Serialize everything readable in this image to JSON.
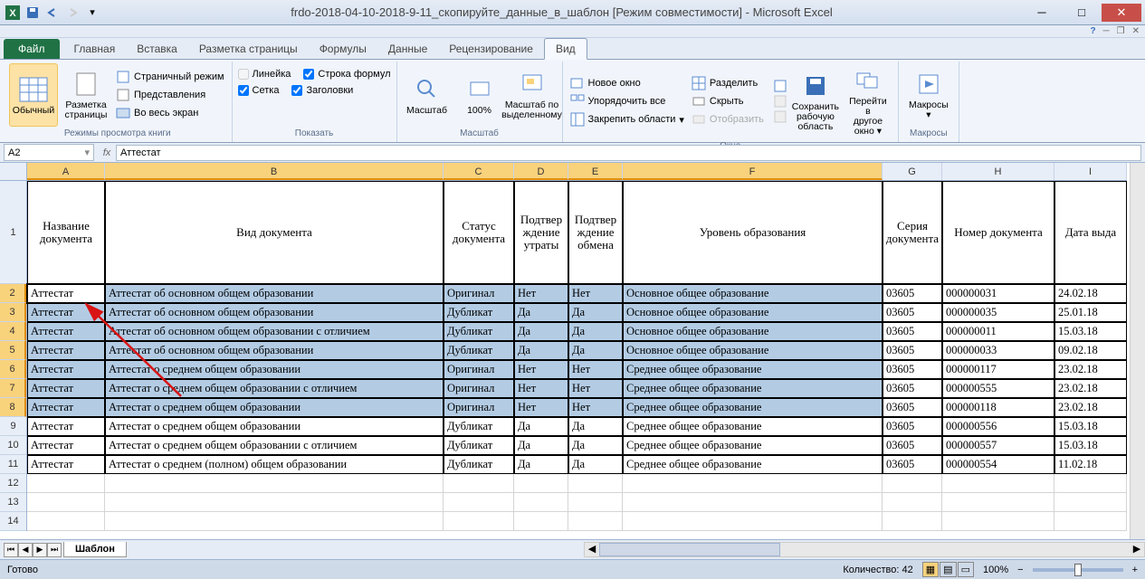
{
  "title": "frdo-2018-04-10-2018-9-11_скопируйте_данные_в_шаблон  [Режим совместимости] - Microsoft Excel",
  "ribbon_tabs": {
    "file": "Файл",
    "items": [
      "Главная",
      "Вставка",
      "Разметка страницы",
      "Формулы",
      "Данные",
      "Рецензирование",
      "Вид"
    ],
    "active": "Вид"
  },
  "ribbon": {
    "modes": {
      "normal": "Обычный",
      "page_layout": "Разметка\nстраницы",
      "page_break": "Страничный режим",
      "custom_views": "Представления",
      "full_screen": "Во весь экран",
      "group": "Режимы просмотра книги"
    },
    "show": {
      "ruler": "Линейка",
      "gridlines": "Сетка",
      "formula_bar": "Строка формул",
      "headings": "Заголовки",
      "group": "Показать"
    },
    "zoom": {
      "zoom": "Масштаб",
      "z100": "100%",
      "to_selection": "Масштаб по\nвыделенному",
      "group": "Масштаб"
    },
    "window": {
      "new": "Новое окно",
      "arrange": "Упорядочить все",
      "freeze": "Закрепить области",
      "split": "Разделить",
      "hide": "Скрыть",
      "unhide": "Отобразить",
      "save_ws": "Сохранить\nрабочую область",
      "switch": "Перейти в\nдругое окно",
      "group": "Окно"
    },
    "macros": {
      "macros": "Макросы",
      "group": "Макросы"
    }
  },
  "name_box": "A2",
  "formula_value": "Аттестат",
  "columns": [
    "A",
    "B",
    "C",
    "D",
    "E",
    "F",
    "G",
    "H",
    "I"
  ],
  "headers": [
    "Название документа",
    "Вид документа",
    "Статус документа",
    "Подтвер\nждение\nутраты",
    "Подтвер\nждение\nобмена",
    "Уровень образования",
    "Серия\nдокумента",
    "Номер документа",
    "Дата выда"
  ],
  "rows": [
    [
      "Аттестат",
      "Аттестат об основном общем образовании",
      "Оригинал",
      "Нет",
      "Нет",
      "Основное общее образование",
      "03605",
      "000000031",
      "24.02.18"
    ],
    [
      "Аттестат",
      "Аттестат об основном общем образовании",
      "Дубликат",
      "Да",
      "Да",
      "Основное общее образование",
      "03605",
      "000000035",
      "25.01.18"
    ],
    [
      "Аттестат",
      "Аттестат об основном общем образовании с отличием",
      "Дубликат",
      "Да",
      "Да",
      "Основное общее образование",
      "03605",
      "000000011",
      "15.03.18"
    ],
    [
      "Аттестат",
      "Аттестат об основном общем образовании",
      "Дубликат",
      "Да",
      "Да",
      "Основное общее образование",
      "03605",
      "000000033",
      "09.02.18"
    ],
    [
      "Аттестат",
      "Аттестат о среднем общем образовании",
      "Оригинал",
      "Нет",
      "Нет",
      "Среднее общее образование",
      "03605",
      "000000117",
      "23.02.18"
    ],
    [
      "Аттестат",
      "Аттестат о среднем общем образовании с отличием",
      "Оригинал",
      "Нет",
      "Нет",
      "Среднее общее образование",
      "03605",
      "000000555",
      "23.02.18"
    ],
    [
      "Аттестат",
      "Аттестат о среднем общем образовании",
      "Оригинал",
      "Нет",
      "Нет",
      "Среднее общее образование",
      "03605",
      "000000118",
      "23.02.18"
    ],
    [
      "Аттестат",
      "Аттестат о среднем общем образовании",
      "Дубликат",
      "Да",
      "Да",
      "Среднее общее образование",
      "03605",
      "000000556",
      "15.03.18"
    ],
    [
      "Аттестат",
      "Аттестат о среднем общем образовании с отличием",
      "Дубликат",
      "Да",
      "Да",
      "Среднее общее образование",
      "03605",
      "000000557",
      "15.03.18"
    ],
    [
      "Аттестат",
      "Аттестат о среднем (полном) общем образовании",
      "Дубликат",
      "Да",
      "Да",
      "Среднее общее образование",
      "03605",
      "000000554",
      "11.02.18"
    ]
  ],
  "selected_rows": 7,
  "sheet_tab": "Шаблон",
  "status": {
    "ready": "Готово",
    "count_label": "Количество:",
    "count": "42",
    "zoom": "100%"
  }
}
